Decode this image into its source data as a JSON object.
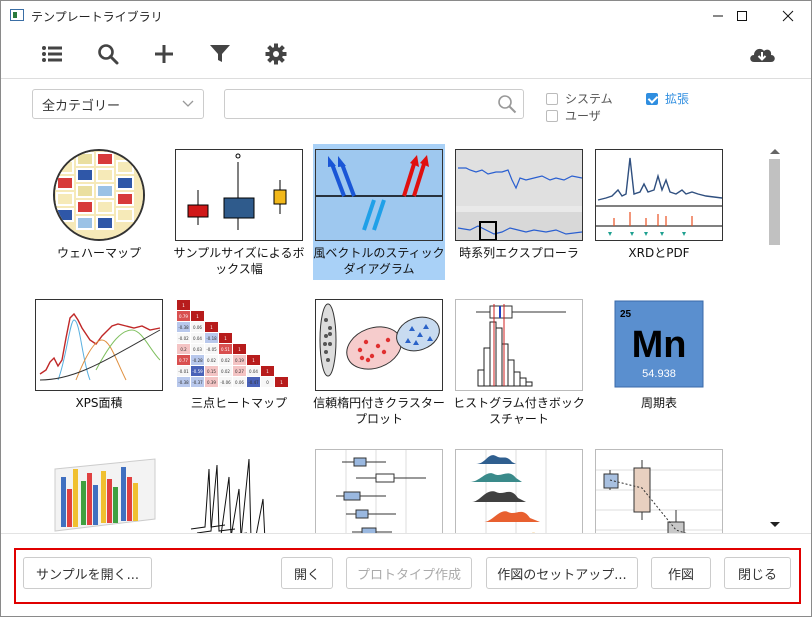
{
  "window": {
    "title": "テンプレートライブラリ",
    "minimize": "—",
    "maximize": "☐",
    "close": "✕"
  },
  "toolbar": {
    "icons": [
      "list-icon",
      "search-icon",
      "plus-icon",
      "filter-icon",
      "gear-icon",
      "cloud-download-icon"
    ]
  },
  "filter": {
    "category": "全カテゴリー",
    "search_placeholder": "",
    "checkboxes": [
      {
        "label": "システム",
        "checked": false
      },
      {
        "label": "ユーザ",
        "checked": false
      },
      {
        "label": "拡張",
        "checked": true
      }
    ]
  },
  "accent": "#2f8ee0",
  "selected_bg": "#a9d1f7",
  "tiles": [
    {
      "label": "ウェハーマップ"
    },
    {
      "label": "サンプルサイズによるボックス幅"
    },
    {
      "label": "風ベクトルのスティックダイアグラム",
      "selected": true
    },
    {
      "label": "時系列エクスプローラ"
    },
    {
      "label": "XRDとPDF"
    },
    {
      "label": "XPS面積"
    },
    {
      "label": "三点ヒートマップ"
    },
    {
      "label": "信頼楕円付きクラスタープロット"
    },
    {
      "label": "ヒストグラム付きボックスチャート"
    },
    {
      "label": "周期表",
      "element_symbol": "Mn",
      "atomic_number": "25",
      "atomic_mass": "54.938"
    },
    {
      "label": ""
    },
    {
      "label": ""
    },
    {
      "label": ""
    },
    {
      "label": ""
    },
    {
      "label": ""
    }
  ],
  "heatmap_values": [
    [
      "1"
    ],
    [
      "0.79",
      "1"
    ],
    [
      "-0.38",
      "0.06",
      "1"
    ],
    [
      "-0.02",
      "0.04",
      "-0.18",
      "1"
    ],
    [
      "0.2",
      "0.03",
      "-0.05",
      "0.51",
      "1"
    ],
    [
      "0.77",
      "-0.28",
      "0.02",
      "0.02",
      "0.19",
      "1"
    ],
    [
      "-0.01",
      "-0.59",
      "0.15",
      "0.02",
      "0.27",
      "0.04",
      "1"
    ],
    [
      "-0.38",
      "-0.37",
      "0.39",
      "-0.06",
      "0.06",
      "-0.47",
      "0",
      "1"
    ]
  ],
  "footer": {
    "open_sample": "サンプルを開く...",
    "open": "開く",
    "prototype": "プロトタイプ作成",
    "setup": "作図のセットアップ...",
    "plot": "作図",
    "close": "閉じる"
  }
}
